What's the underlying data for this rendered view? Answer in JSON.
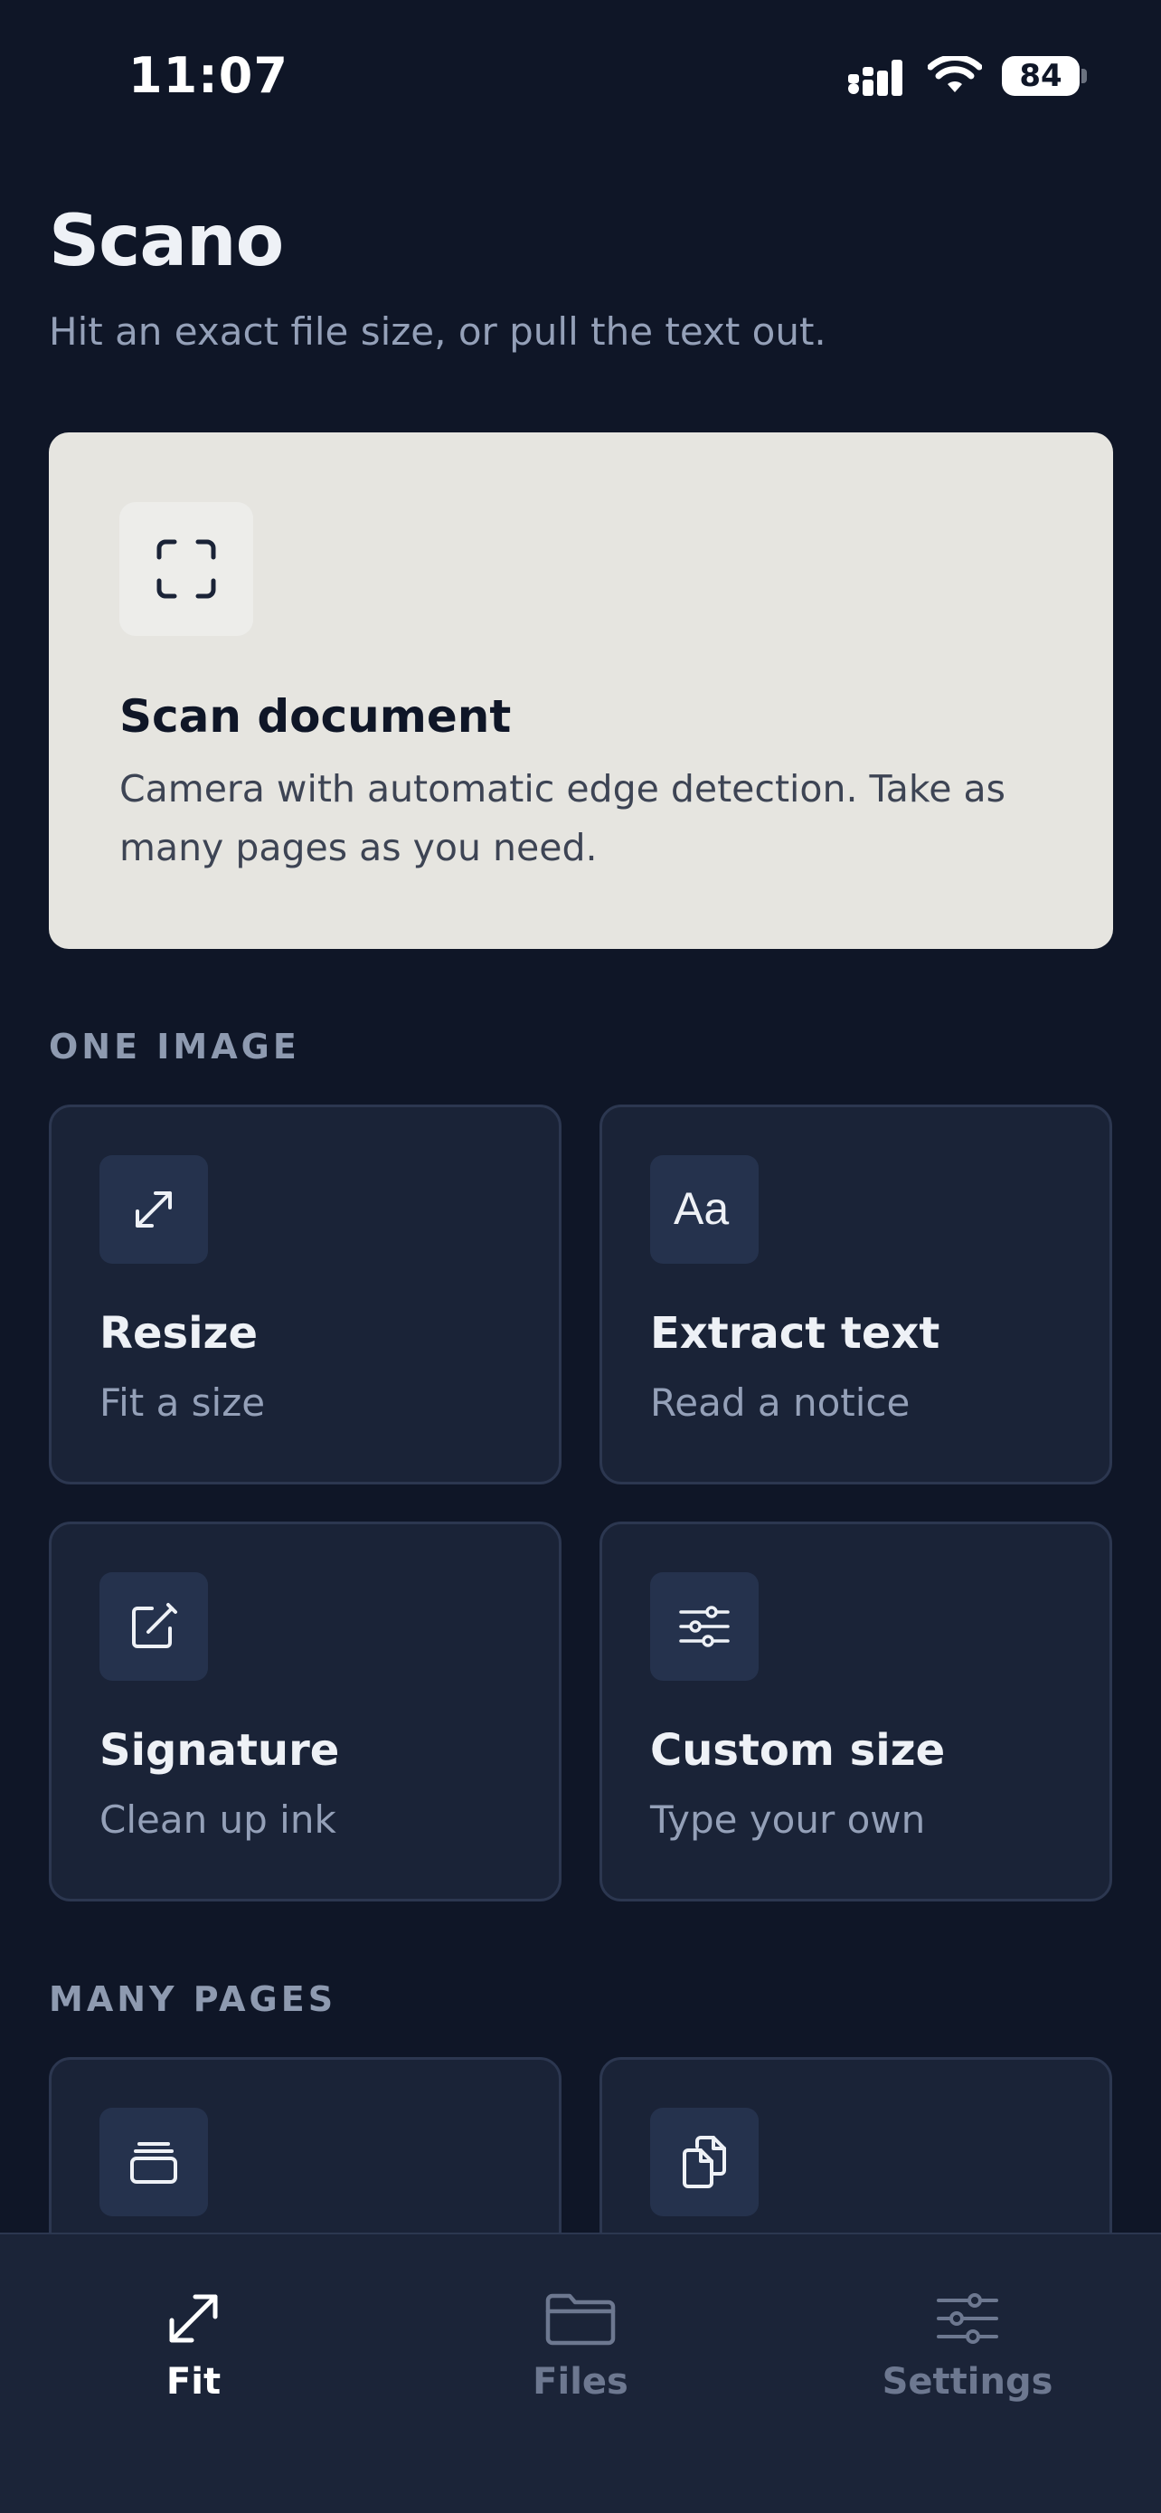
{
  "status_bar": {
    "time": "11:07",
    "battery": "84"
  },
  "header": {
    "title": "Scano",
    "subtitle": "Hit an exact file size, or pull the text out."
  },
  "scan_card": {
    "title": "Scan document",
    "description": "Camera with automatic edge detection. Take as many pages as you need.",
    "icon": "scan-frame-icon"
  },
  "sections": {
    "one_image": {
      "label": "ONE IMAGE",
      "tiles": [
        {
          "title": "Resize",
          "subtitle": "Fit a size",
          "icon": "resize-arrows-icon"
        },
        {
          "title": "Extract text",
          "subtitle": "Read a notice",
          "icon": "text-aa-icon"
        },
        {
          "title": "Signature",
          "subtitle": "Clean up ink",
          "icon": "signature-edit-icon"
        },
        {
          "title": "Custom size",
          "subtitle": "Type your own",
          "icon": "sliders-icon"
        }
      ]
    },
    "many_pages": {
      "label": "MANY PAGES",
      "tiles": [
        {
          "title": "",
          "subtitle": "",
          "icon": "stack-icon"
        },
        {
          "title": "",
          "subtitle": "",
          "icon": "documents-icon"
        }
      ]
    }
  },
  "tab_bar": {
    "tabs": [
      {
        "label": "Fit",
        "icon": "resize-arrows-icon",
        "active": true
      },
      {
        "label": "Files",
        "icon": "folder-icon",
        "active": false
      },
      {
        "label": "Settings",
        "icon": "sliders-icon",
        "active": false
      }
    ]
  },
  "colors": {
    "background": "#0f1627",
    "card": "#1a2337",
    "scan_card": "#e6e5e0",
    "icon_box": "#25324d",
    "text_primary": "#eef1f6",
    "text_secondary": "#94a0b8",
    "tab_inactive": "#6d7890"
  }
}
